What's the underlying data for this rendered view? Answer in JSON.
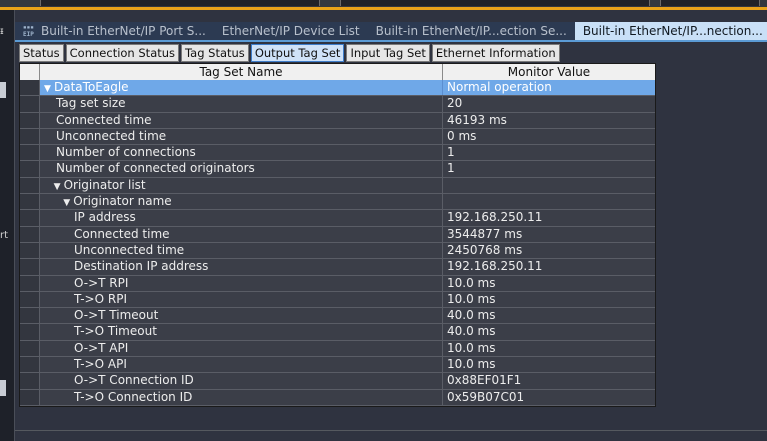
{
  "tabs": [
    {
      "label": "Built-in EtherNet/IP Port S...",
      "active": false,
      "icon": "eip-icon"
    },
    {
      "label": "EtherNet/IP Device List",
      "active": false
    },
    {
      "label": "Built-in EtherNet/IP...ection Se...",
      "active": false
    },
    {
      "label": "Built-in EtherNet/IP...nection...",
      "active": true
    }
  ],
  "subtabs": [
    {
      "label": "Status",
      "active": false
    },
    {
      "label": "Connection Status",
      "active": false
    },
    {
      "label": "Tag Status",
      "active": false
    },
    {
      "label": "Output Tag Set",
      "active": true
    },
    {
      "label": "Input Tag Set",
      "active": false
    },
    {
      "label": "Ethernet Information",
      "active": false
    }
  ],
  "grid": {
    "col_name": "Tag Set Name",
    "col_value": "Monitor Value",
    "rows": [
      {
        "name": "DataToEagle",
        "value": "Normal operation",
        "level": 0,
        "expander": "▼",
        "selected": true
      },
      {
        "name": "Tag set size",
        "value": "20",
        "level": 1
      },
      {
        "name": "Connected time",
        "value": "46193 ms",
        "level": 1
      },
      {
        "name": "Unconnected time",
        "value": "0 ms",
        "level": 1
      },
      {
        "name": "Number of connections",
        "value": "1",
        "level": 1
      },
      {
        "name": "Number of connected originators",
        "value": "1",
        "level": 1
      },
      {
        "name": "Originator list",
        "value": "",
        "level": 0.8,
        "expander": "▼"
      },
      {
        "name": "Originator name",
        "value": "",
        "level": 1.6,
        "expander": "▼"
      },
      {
        "name": "IP address",
        "value": "192.168.250.11",
        "level": 2.5
      },
      {
        "name": "Connected time",
        "value": "3544877 ms",
        "level": 2.5
      },
      {
        "name": "Unconnected time",
        "value": "2450768 ms",
        "level": 2.5
      },
      {
        "name": "Destination IP address",
        "value": "192.168.250.11",
        "level": 2.5
      },
      {
        "name": "O->T RPI",
        "value": "10.0 ms",
        "level": 2.5
      },
      {
        "name": "T->O RPI",
        "value": "10.0 ms",
        "level": 2.5
      },
      {
        "name": "O->T Timeout",
        "value": "40.0 ms",
        "level": 2.5
      },
      {
        "name": "T->O Timeout",
        "value": "40.0 ms",
        "level": 2.5
      },
      {
        "name": "O->T API",
        "value": "10.0 ms",
        "level": 2.5
      },
      {
        "name": "T->O API",
        "value": "10.0 ms",
        "level": 2.5
      },
      {
        "name": "O->T Connection ID",
        "value": "0x88EF01F1",
        "level": 2.5
      },
      {
        "name": "T->O Connection ID",
        "value": "0x59B07C01",
        "level": 2.5
      }
    ]
  },
  "left_panel": {
    "fragment": "rt"
  },
  "colors": {
    "accent": "#e8a219",
    "selected": "#6fa8e8",
    "active_tab": "#c9e0f7"
  }
}
